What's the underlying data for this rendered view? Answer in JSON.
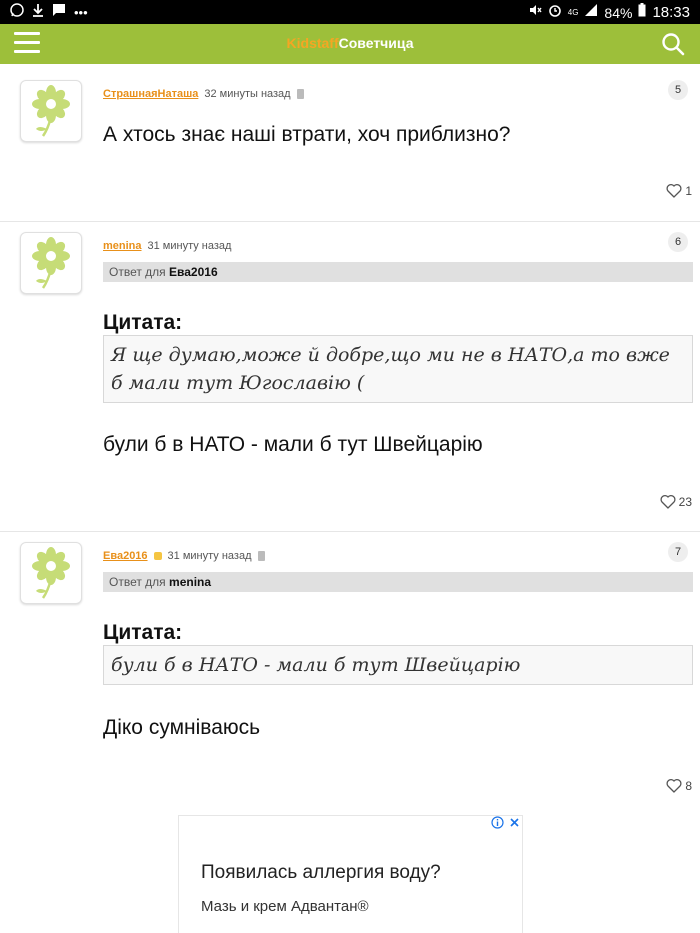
{
  "status_bar": {
    "battery": "84%",
    "time": "18:33",
    "network": "4G"
  },
  "app_bar": {
    "brand_part1": "Kidstaff",
    "brand_part2": "Советчица"
  },
  "comments": [
    {
      "author": "СтрашнаяНаташа",
      "time": "32 минуты назад",
      "number": "5",
      "text": "А хтось знає наші втрати, хоч приблизно?",
      "likes": "1"
    },
    {
      "author": "menina",
      "time": "31 минуту назад",
      "number": "6",
      "reply_prefix": "Ответ для",
      "reply_to": "Ева2016",
      "quote_label": "Цитата:",
      "quote": "Я ще думаю,може й добре,що ми не в НАТО,а то вже б мали тут Югославію (",
      "text": "були б в НАТО - мали б тут Швейцарію",
      "likes": "23"
    },
    {
      "author": "Ева2016",
      "time": "31 минуту назад",
      "number": "7",
      "reply_prefix": "Ответ для",
      "reply_to": "menina",
      "quote_label": "Цитата:",
      "quote": "були б в НАТО - мали б тут Швейцарію",
      "text": "Діко сумніваюсь",
      "likes": "8"
    }
  ],
  "ad": {
    "title": "Появилась аллергия воду?",
    "subtitle": "Мазь и крем Адвантан®"
  },
  "colors": {
    "app_bar": "#9dbf3a",
    "author": "#e8901a",
    "brand_accent": "#f5a623"
  }
}
